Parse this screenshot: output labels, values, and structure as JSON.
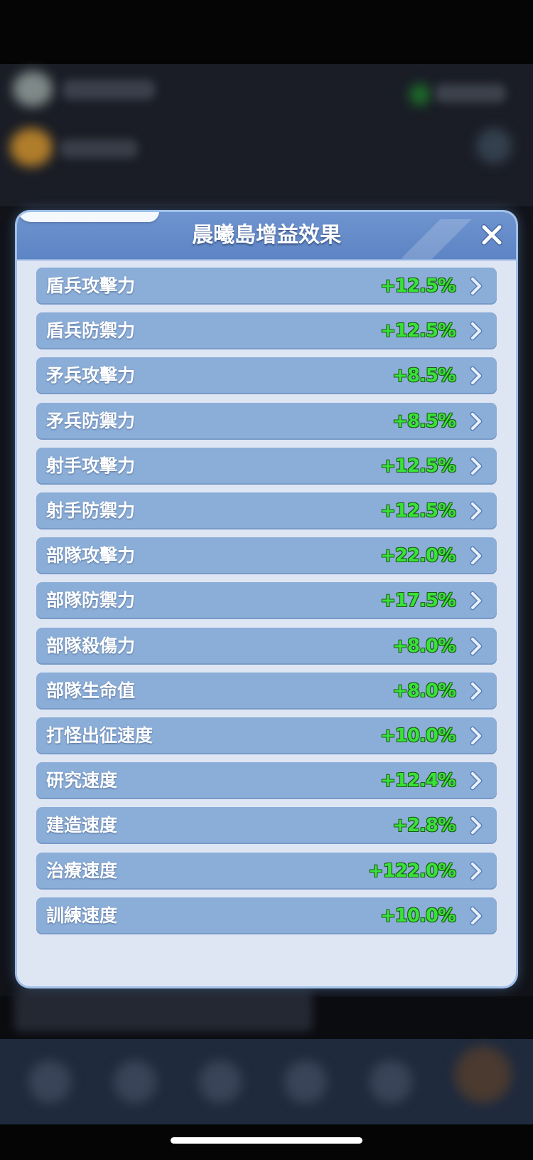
{
  "dialog": {
    "title": "晨曦島增益效果"
  },
  "buffs": [
    {
      "label": "盾兵攻擊力",
      "value": "+12.5%"
    },
    {
      "label": "盾兵防禦力",
      "value": "+12.5%"
    },
    {
      "label": "矛兵攻擊力",
      "value": "+8.5%"
    },
    {
      "label": "矛兵防禦力",
      "value": "+8.5%"
    },
    {
      "label": "射手攻擊力",
      "value": "+12.5%"
    },
    {
      "label": "射手防禦力",
      "value": "+12.5%"
    },
    {
      "label": "部隊攻擊力",
      "value": "+22.0%"
    },
    {
      "label": "部隊防禦力",
      "value": "+17.5%"
    },
    {
      "label": "部隊殺傷力",
      "value": "+8.0%"
    },
    {
      "label": "部隊生命值",
      "value": "+8.0%"
    },
    {
      "label": "打怪出征速度",
      "value": "+10.0%"
    },
    {
      "label": "研究速度",
      "value": "+12.4%"
    },
    {
      "label": "建造速度",
      "value": "+2.8%"
    },
    {
      "label": "治療速度",
      "value": "+122.0%"
    },
    {
      "label": "訓練速度",
      "value": "+10.0%"
    }
  ],
  "colors": {
    "value_green": "#39e23a",
    "row_bg": "#8baed8",
    "header_bg": "#5d84c4"
  },
  "icons": {
    "close": "close-icon",
    "chevron": "chevron-right-icon"
  }
}
